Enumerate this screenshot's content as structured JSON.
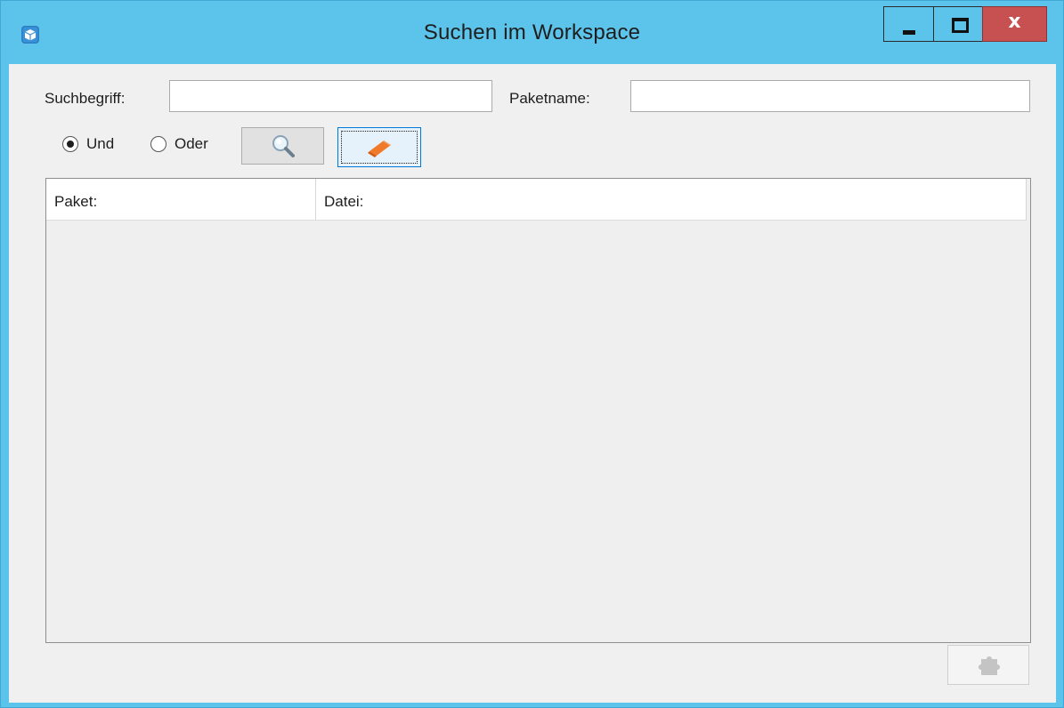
{
  "window": {
    "title": "Suchen im Workspace",
    "app_icon": "package-icon",
    "minimize_icon": "minimize-icon",
    "maximize_icon": "maximize-icon",
    "close_label": "x",
    "accent_color": "#5cc3ea",
    "close_color": "#c75050"
  },
  "search": {
    "term_label": "Suchbegriff:",
    "term_value": "",
    "package_label": "Paketname:",
    "package_value": ""
  },
  "mode": {
    "and_label": "Und",
    "or_label": "Oder",
    "selected": "Und"
  },
  "toolbar": {
    "search_icon": "magnifier-icon",
    "clear_icon": "eraser-icon"
  },
  "results": {
    "columns": [
      "Paket:",
      "Datei:"
    ],
    "rows": []
  },
  "footer": {
    "action_icon": "puzzle-icon",
    "action_enabled": false
  }
}
